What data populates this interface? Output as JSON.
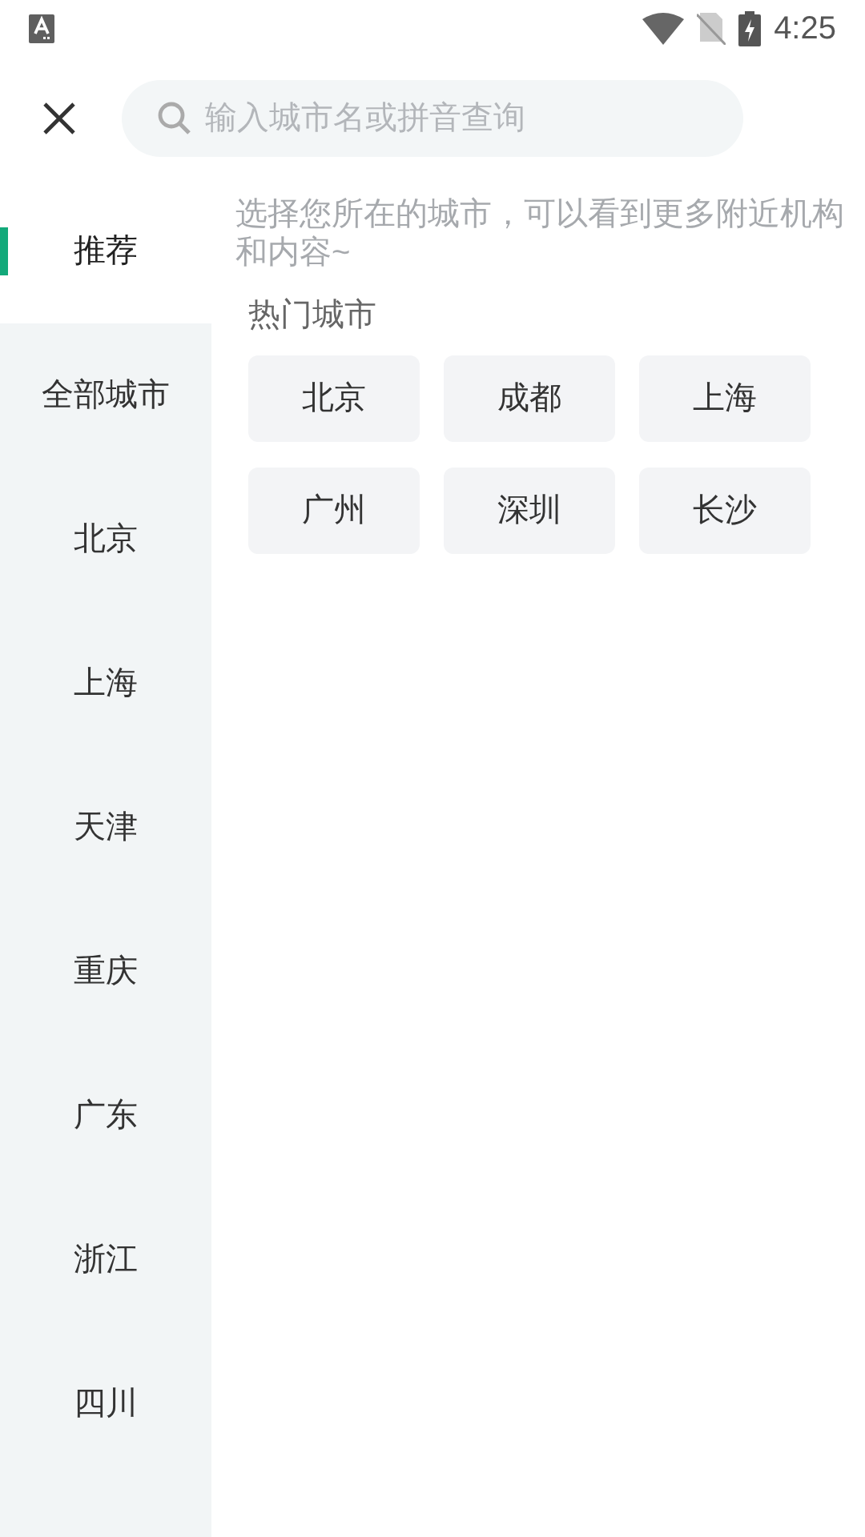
{
  "status_bar": {
    "time": "4:25"
  },
  "search": {
    "placeholder": "输入城市名或拼音查询"
  },
  "sidebar": {
    "items": [
      {
        "label": "推荐",
        "selected": true
      },
      {
        "label": "全部城市",
        "selected": false
      },
      {
        "label": "北京",
        "selected": false
      },
      {
        "label": "上海",
        "selected": false
      },
      {
        "label": "天津",
        "selected": false
      },
      {
        "label": "重庆",
        "selected": false
      },
      {
        "label": "广东",
        "selected": false
      },
      {
        "label": "浙江",
        "selected": false
      },
      {
        "label": "四川",
        "selected": false
      }
    ]
  },
  "hint": "选择您所在的城市，可以看到更多附近机构和内容~",
  "hot_cities": {
    "title": "热门城市",
    "cities": [
      "北京",
      "成都",
      "上海",
      "广州",
      "深圳",
      "长沙"
    ]
  }
}
